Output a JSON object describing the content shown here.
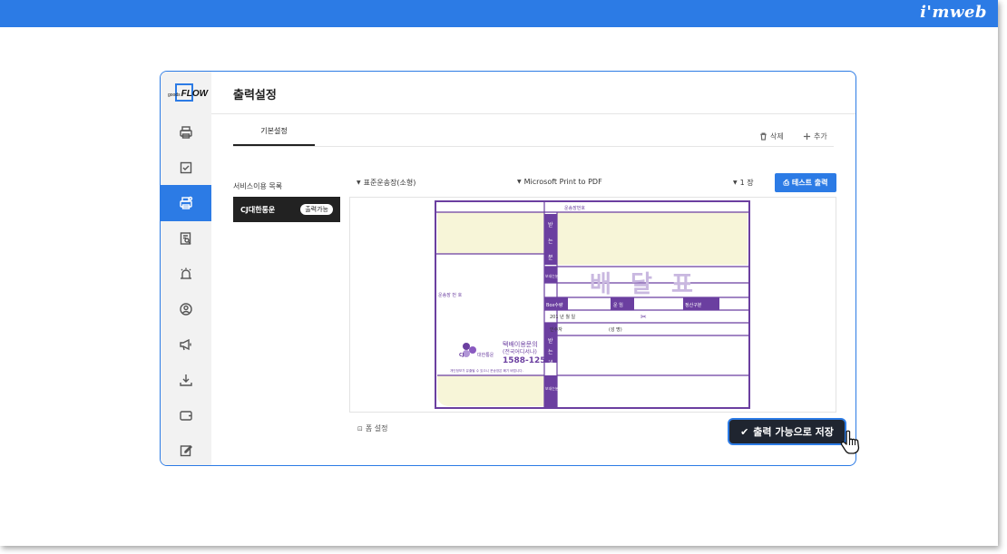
{
  "brand": {
    "imweb_logo": "i'mweb",
    "app_logo_small": "goods",
    "app_logo": "FLOW"
  },
  "sidebar": {
    "items": [
      {
        "icon": "printer-icon"
      },
      {
        "icon": "checkbox-icon"
      },
      {
        "icon": "print-settings-icon",
        "active": true
      },
      {
        "icon": "document-search-icon"
      },
      {
        "icon": "alarm-icon"
      },
      {
        "icon": "user-circle-icon"
      },
      {
        "icon": "megaphone-icon"
      },
      {
        "icon": "download-icon"
      },
      {
        "icon": "wallet-icon"
      },
      {
        "icon": "edit-icon"
      }
    ]
  },
  "main": {
    "title": "출력설정",
    "tabs": [
      {
        "label": "기본설정",
        "active": true
      }
    ],
    "toolbar": {
      "delete_label": "삭제",
      "add_label": "추가"
    },
    "service": {
      "section_label": "서비스이용 목록",
      "item_name": "CJ대한통운",
      "item_badge": "출력가능"
    },
    "selects": {
      "form": "표준운송장(소형)",
      "printer": "Microsoft Print to PDF",
      "copies": "1 장"
    },
    "test_print_label": "테스트 출력",
    "form_settings_label": "폼 설정"
  },
  "waybill": {
    "tracking_header": "운송장번호",
    "receiver_vertical": [
      "받",
      "는",
      "분"
    ],
    "sender_label": "보내는분",
    "delivery_title": "배 달 표",
    "box_label": "Box수량",
    "fare_label": "운 임",
    "payment_label": "정산구분",
    "date_row": "201 년 월 일",
    "recipient_label": "인수자",
    "recipient_sign": "(성 명)",
    "receiver_vertical2": [
      "받",
      "는",
      "분"
    ],
    "sender_label2": "보내는분",
    "tracking_side": "운송장 번 호",
    "company_name": "대한통운",
    "inquiry_title": "택배이용문의",
    "inquiry_sub": "(전국어디서나)",
    "phone": "1588-1255",
    "privacy_note": "개인정보가 유출될 수 있으니 운송장은 폐기 바랍니다."
  },
  "toast": {
    "label": "출력 가능으로 저장"
  },
  "colors": {
    "accent": "#2c7be5",
    "waybill_purple": "#6b3fa0",
    "waybill_yellow": "#f7f5d8"
  }
}
